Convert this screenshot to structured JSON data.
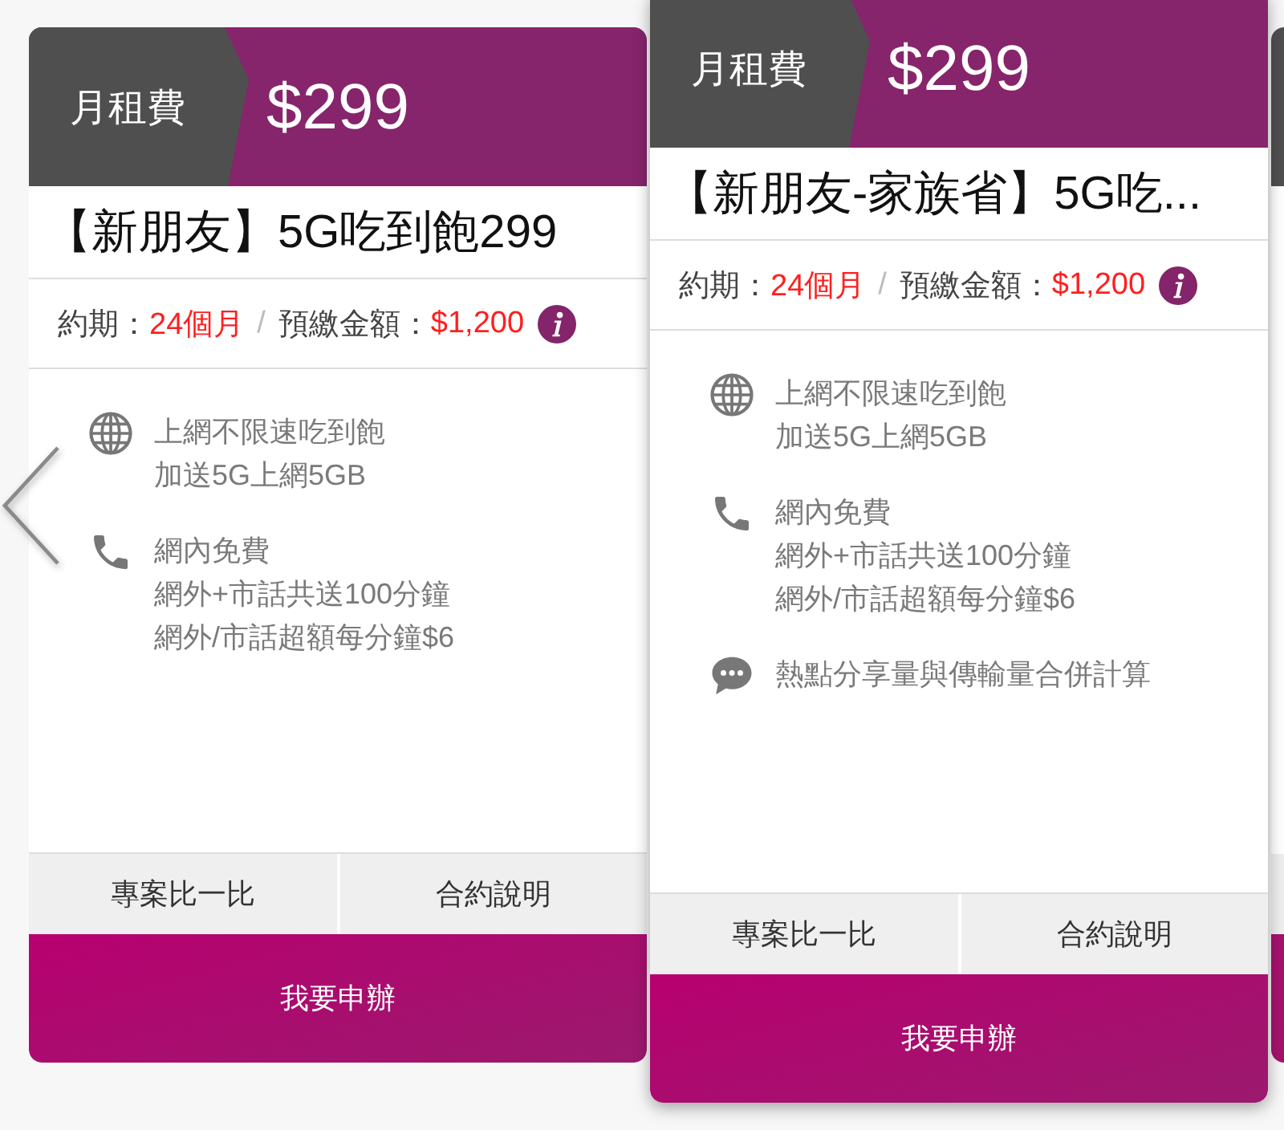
{
  "nav": {
    "previous": true
  },
  "cards": [
    {
      "selected": false,
      "price_label": "月租費",
      "price": "$299",
      "title": "【新朋友】5G吃到飽299",
      "contract": {
        "period_label": "約期：",
        "period": "24個月",
        "separator": "/",
        "deposit_label": "預繳金額：",
        "deposit": "$1,200"
      },
      "features": [
        {
          "kind": "globe",
          "lines": [
            "上網不限速吃到飽",
            "加送5G上網5GB"
          ]
        },
        {
          "kind": "phone",
          "lines": [
            "網內免費",
            "網外+市話共送100分鐘",
            "網外/市話超額每分鐘$6"
          ]
        }
      ],
      "buttons": [
        "專案比一比",
        "合約說明"
      ],
      "apply_button": "我要申辦"
    },
    {
      "selected": true,
      "price_label": "月租費",
      "price": "$299",
      "title": "【新朋友-家族省】5G吃...",
      "contract": {
        "period_label": "約期：",
        "period": "24個月",
        "separator": "/",
        "deposit_label": "預繳金額：",
        "deposit": "$1,200"
      },
      "features": [
        {
          "kind": "globe",
          "lines": [
            "上網不限速吃到飽",
            "加送5G上網5GB"
          ]
        },
        {
          "kind": "phone",
          "lines": [
            "網內免費",
            "網外+市話共送100分鐘",
            "網外/市話超額每分鐘$6"
          ]
        },
        {
          "kind": "chat",
          "lines": [
            "熱點分享量與傳輸量合併計算"
          ]
        }
      ],
      "buttons": [
        "專案比一比",
        "合約說明"
      ],
      "apply_button": "我要申辦"
    }
  ]
}
